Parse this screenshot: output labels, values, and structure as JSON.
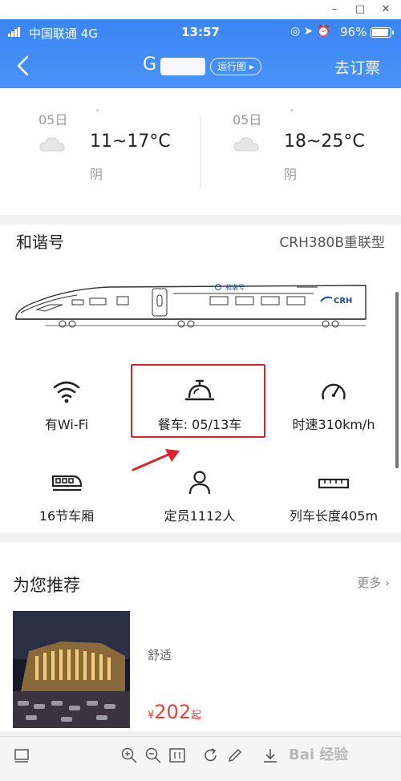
{
  "status_bar": {
    "carrier": "中国联通  4G",
    "time": "13:57",
    "battery_percent": "96%",
    "battery_level": 0.96
  },
  "nav": {
    "train_number": "G",
    "route_map_label": "运行图",
    "buy_ticket_label": "去订票"
  },
  "weather": [
    {
      "date": "05日",
      "temp": "11~17°C",
      "condition": "阴",
      "icon": "cloud-icon"
    },
    {
      "date": "05日",
      "temp": "18~25°C",
      "condition": "阴",
      "icon": "cloud-icon"
    }
  ],
  "train": {
    "name": "和谐号",
    "model": "CRH380B重联型",
    "image_text": {
      "logo": "和谐号",
      "brand": "CRH"
    },
    "features": [
      {
        "icon": "wifi-icon",
        "label": "有Wi-Fi"
      },
      {
        "icon": "dining-bell-icon",
        "label": "餐车: 05/13车"
      },
      {
        "icon": "speedometer-icon",
        "label": "时速310km/h"
      },
      {
        "icon": "train-icon",
        "label": "16节车厢"
      },
      {
        "icon": "person-icon",
        "label": "定员1112人"
      },
      {
        "icon": "ruler-icon",
        "label": "列车长度405m"
      }
    ]
  },
  "recommend": {
    "title": "为您推荐",
    "more_label": "更多",
    "hotel": {
      "tag": "舒适",
      "currency": "¥",
      "price": "202",
      "price_suffix": "起"
    }
  },
  "toolbar": {
    "icons": [
      "page-view-icon",
      "zoom-in-icon",
      "zoom-out-icon",
      "actual-size-icon",
      "rotate-icon",
      "pen-icon",
      "download-icon"
    ],
    "watermark": "Bai  经验"
  },
  "colors": {
    "header_blue": "#3a86f5",
    "highlight_red": "#e0202a",
    "price_red": "#f23e3e"
  }
}
